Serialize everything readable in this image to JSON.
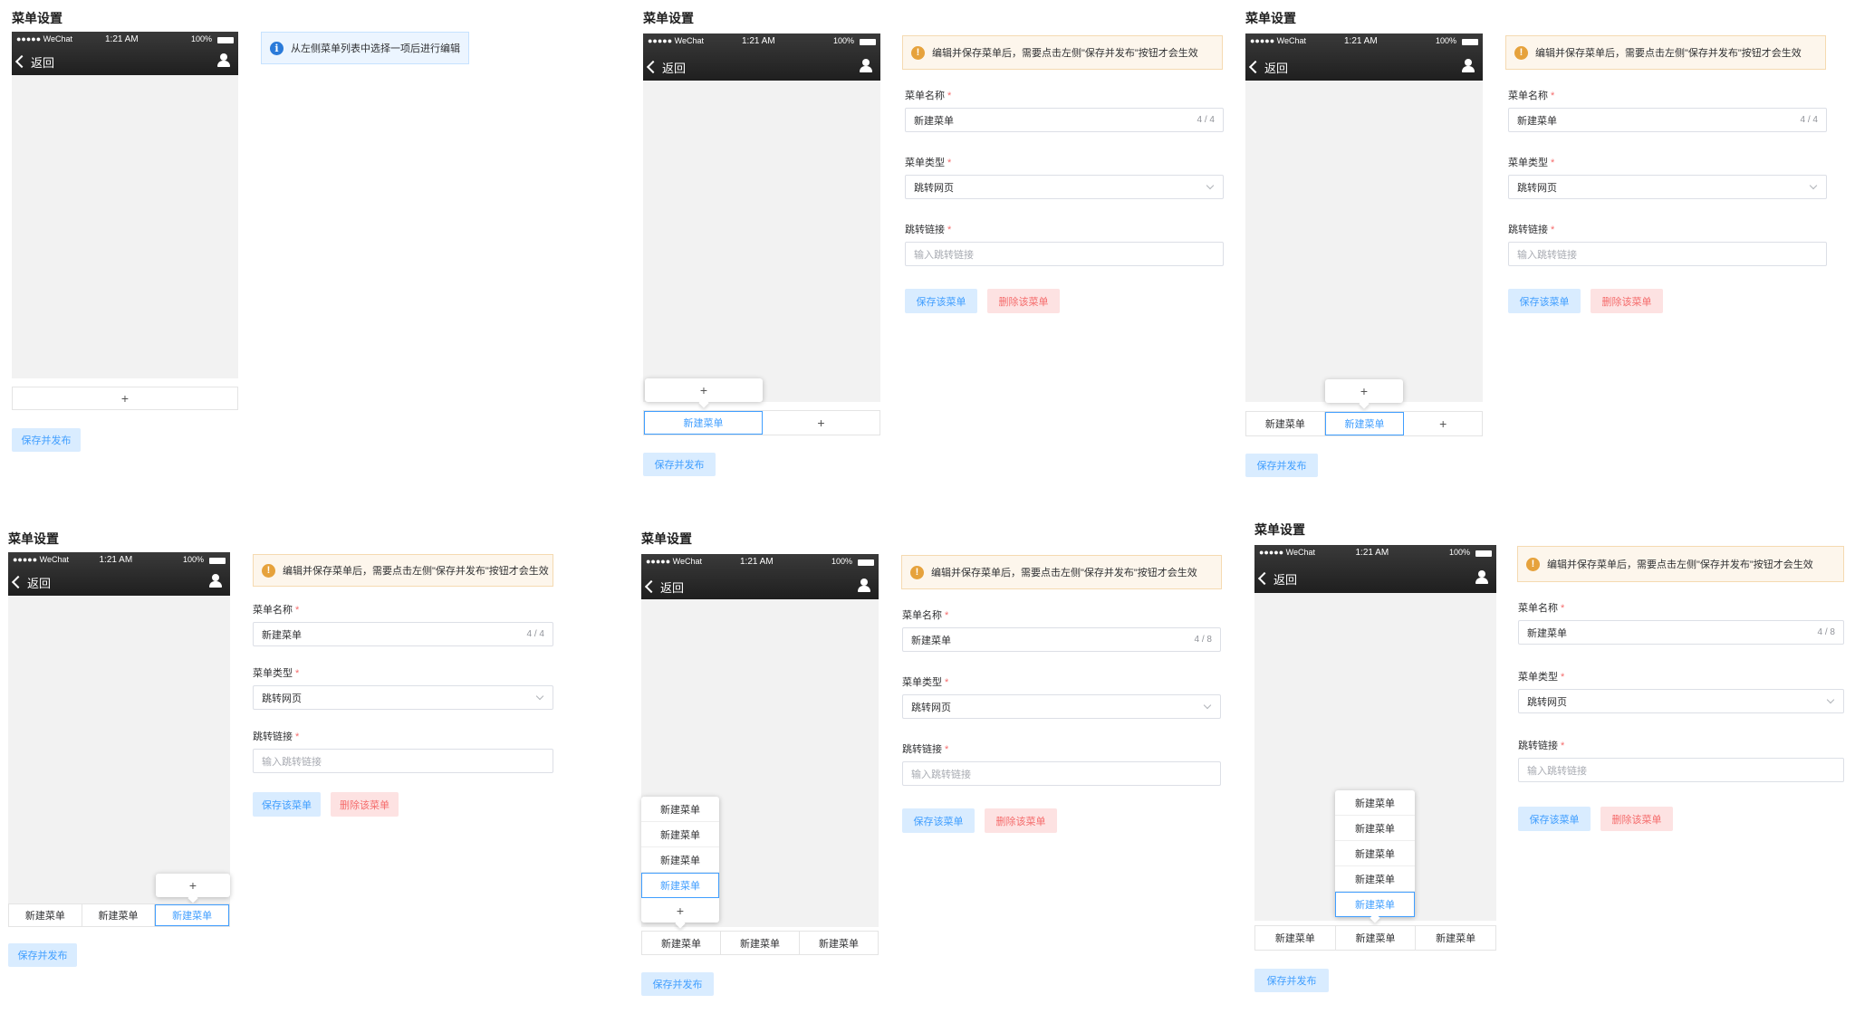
{
  "page_title": "菜单设置",
  "phone": {
    "carrier": "●●●●● WeChat",
    "time": "1:21 AM",
    "battery": "100%",
    "back_label": "返回"
  },
  "menu": {
    "new_label": "新建菜单",
    "add_symbol": "+",
    "publish_label": "保存并发布"
  },
  "notices": {
    "select_tip": "从左侧菜单列表中选择一项后进行编辑",
    "save_tip": "编辑并保存菜单后，需要点击左侧\"保存并发布\"按钮才会生效",
    "info_icon": "i",
    "warn_icon": "!"
  },
  "form": {
    "name_label": "菜单名称",
    "name_value": "新建菜单",
    "name_count_4": "4 / 4",
    "name_count_8": "4 / 8",
    "type_label": "菜单类型",
    "type_value": "跳转网页",
    "link_label": "跳转链接",
    "link_placeholder": "输入跳转链接",
    "required_mark": "*",
    "save_item_label": "保存该菜单",
    "delete_item_label": "删除该菜单"
  },
  "colors": {
    "accent": "#409eff",
    "danger": "#f56c6c",
    "warning": "#e6a23c"
  }
}
